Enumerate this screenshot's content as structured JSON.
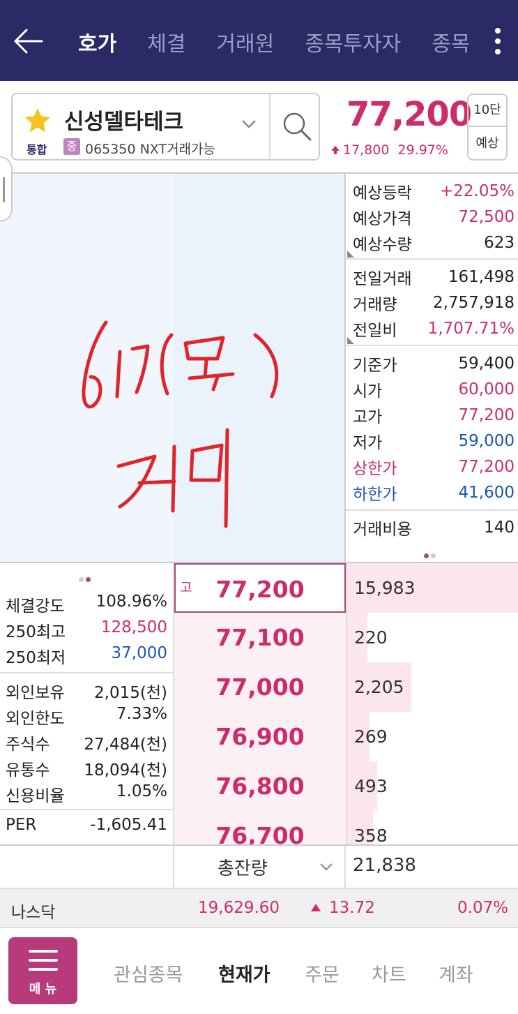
{
  "topbar": {
    "tabs": [
      "호가",
      "체결",
      "거래원",
      "종목투자자",
      "종목"
    ]
  },
  "stock": {
    "name": "신성델타테크",
    "market": "통합",
    "market_badge": "중",
    "code_info": "065350 NXT거래가능",
    "price": "77,200",
    "change": "17,800",
    "change_pct": "29.97%",
    "btn_depth": "10단",
    "btn_expected": "예상"
  },
  "info_panel": {
    "expected": [
      {
        "label": "예상등락",
        "value": "+22.05%",
        "tone": "pink"
      },
      {
        "label": "예상가격",
        "value": "72,500",
        "tone": "pink"
      },
      {
        "label": "예상수량",
        "value": "623",
        "tone": ""
      }
    ],
    "volume": [
      {
        "label": "전일거래",
        "value": "161,498",
        "tone": ""
      },
      {
        "label": "거래량",
        "value": "2,757,918",
        "tone": ""
      },
      {
        "label": "전일비",
        "value": "1,707.71%",
        "tone": "pink"
      }
    ],
    "prices": [
      {
        "label": "기준가",
        "value": "59,400",
        "tone": "",
        "label_tone": ""
      },
      {
        "label": "시가",
        "value": "60,000",
        "tone": "pink",
        "label_tone": ""
      },
      {
        "label": "고가",
        "value": "77,200",
        "tone": "pink",
        "label_tone": ""
      },
      {
        "label": "저가",
        "value": "59,000",
        "tone": "blue",
        "label_tone": ""
      },
      {
        "label": "상한가",
        "value": "77,200",
        "tone": "pink",
        "label_tone": "pink"
      },
      {
        "label": "하한가",
        "value": "41,600",
        "tone": "blue",
        "label_tone": "blue"
      }
    ],
    "fee": {
      "label": "거래비용",
      "value": "140"
    }
  },
  "left_stats": {
    "group1": [
      {
        "label": "체결강도",
        "value": "108.96%",
        "tone": ""
      },
      {
        "label": "250최고",
        "value": "128,500",
        "tone": "pink"
      },
      {
        "label": "250최저",
        "value": "37,000",
        "tone": "blue"
      }
    ],
    "group2": [
      {
        "label": "외인보유",
        "value": "2,015(천)",
        "tone": ""
      },
      {
        "label": "외인한도",
        "value": "7.33%",
        "tone": ""
      },
      {
        "label": "주식수",
        "value": "27,484(천)",
        "tone": ""
      },
      {
        "label": "유통수",
        "value": "18,094(천)",
        "tone": ""
      },
      {
        "label": "신용비율",
        "value": "1.05%",
        "tone": ""
      }
    ],
    "group3": [
      {
        "label": "PER",
        "value": "-1,605.41",
        "tone": ""
      }
    ]
  },
  "orderbook": {
    "high_mark": "고",
    "rows": [
      {
        "price": "77,200",
        "qty": "15,983",
        "qty_num": 15983,
        "is_high": true
      },
      {
        "price": "77,100",
        "qty": "220",
        "qty_num": 220,
        "is_high": false
      },
      {
        "price": "77,000",
        "qty": "2,205",
        "qty_num": 2205,
        "is_high": false
      },
      {
        "price": "76,900",
        "qty": "269",
        "qty_num": 269,
        "is_high": false
      },
      {
        "price": "76,800",
        "qty": "493",
        "qty_num": 493,
        "is_high": false
      },
      {
        "price": "76,700",
        "qty": "358",
        "qty_num": 358,
        "is_high": false
      }
    ],
    "total_label": "총잔량",
    "total_qty": "21,838"
  },
  "index_bar": {
    "name": "나스닥",
    "value": "19,629.60",
    "change": "13.72",
    "pct": "0.07%"
  },
  "nav": {
    "menu_label": "메 뉴",
    "items": [
      "관심종목",
      "현재가",
      "주문",
      "차트",
      "계좌"
    ],
    "active_index": 1
  },
  "colors": {
    "header_bg": "#2b2a66",
    "up": "#cc2d6a",
    "down": "#1f55b3",
    "menu_bg": "#b73a7a",
    "handwriting": "#e0242a"
  }
}
